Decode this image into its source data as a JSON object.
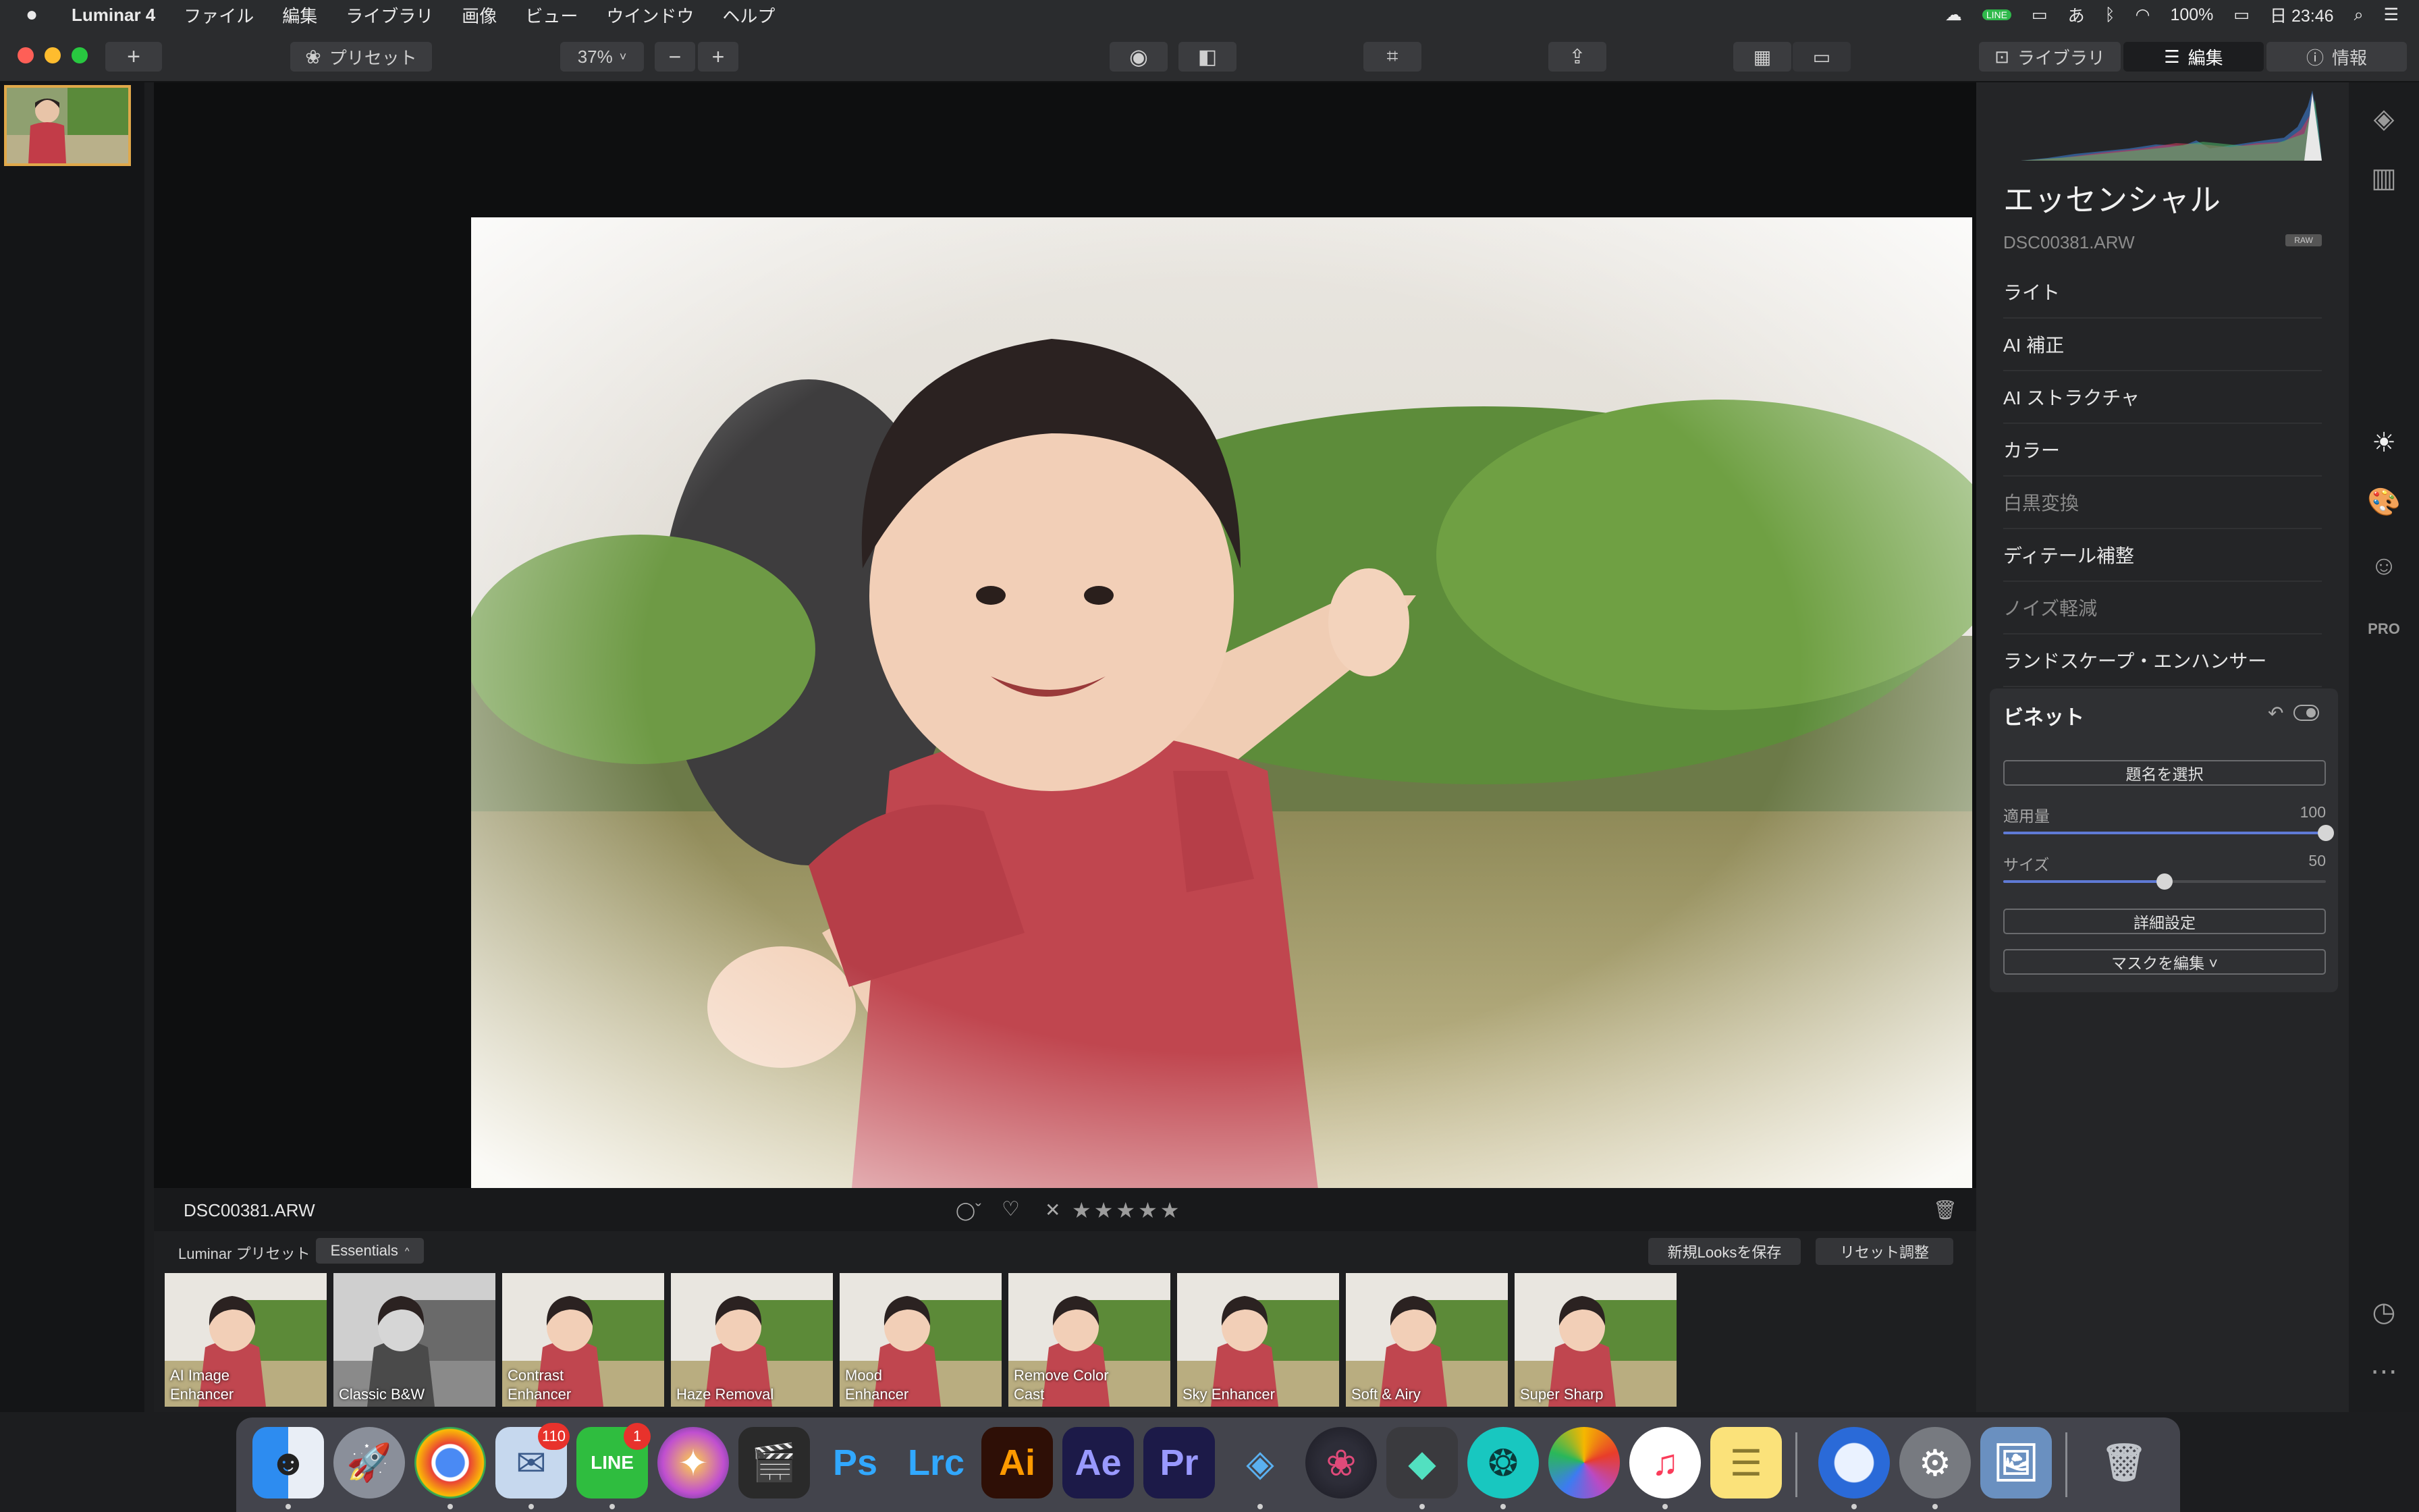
{
  "menubar": {
    "app_name": "Luminar 4",
    "items": [
      "ファイル",
      "編集",
      "ライブラリ",
      "画像",
      "ビュー",
      "ウインドウ",
      "ヘルプ"
    ],
    "battery": "100%",
    "clock": "日 23:46",
    "line_label": "LINE"
  },
  "toolbar": {
    "presets_label": "プリセット",
    "zoom": "37%",
    "zoom_out": "−",
    "zoom_in": "+",
    "add": "+",
    "tab_library": "ライブラリ",
    "tab_edit": "編集",
    "tab_info": "情報"
  },
  "viewer": {
    "filename": "DSC00381.ARW",
    "stars": "★★★★★",
    "reject": "✕",
    "flag_label": "◯ˇ",
    "heart": "♡"
  },
  "presets": {
    "label": "Luminar プリセット",
    "category": "Essentials",
    "save_looks": "新規Looksを保存",
    "reset": "リセット調整",
    "thumbs": [
      {
        "line1": "AI Image",
        "line2": "Enhancer",
        "mono": false
      },
      {
        "line1": "Classic B&W",
        "line2": "",
        "mono": true
      },
      {
        "line1": "Contrast",
        "line2": "Enhancer",
        "mono": false
      },
      {
        "line1": "Haze Removal",
        "line2": "",
        "mono": false
      },
      {
        "line1": "Mood",
        "line2": "Enhancer",
        "mono": false
      },
      {
        "line1": "Remove Color",
        "line2": "Cast",
        "mono": false
      },
      {
        "line1": "Sky Enhancer",
        "line2": "",
        "mono": false
      },
      {
        "line1": "Soft & Airy",
        "line2": "",
        "mono": false
      },
      {
        "line1": "Super Sharp",
        "line2": "",
        "mono": false
      }
    ]
  },
  "panel": {
    "title": "エッセンシャル",
    "filename": "DSC00381.ARW",
    "raw_badge": "RAW",
    "sections": [
      {
        "label": "ライト",
        "dim": false
      },
      {
        "label": "AI 補正",
        "dim": false
      },
      {
        "label": "AI ストラクチャ",
        "dim": false
      },
      {
        "label": "カラー",
        "dim": false
      },
      {
        "label": "白黒変換",
        "dim": true
      },
      {
        "label": "ディテール補整",
        "dim": false
      },
      {
        "label": "ノイズ軽減",
        "dim": true
      },
      {
        "label": "ランドスケープ・エンハンサー",
        "dim": false
      }
    ],
    "vignette": {
      "title": "ビネット",
      "select_subject": "題名を選択",
      "amount_label": "適用量",
      "amount_value": "100",
      "amount_fraction": 1.0,
      "size_label": "サイズ",
      "size_value": "50",
      "size_fraction": 0.5,
      "advanced": "詳細設定",
      "edit_mask": "マスクを編集 ˅"
    },
    "pro_label": "PRO"
  },
  "dock": {
    "mail_badge": "110",
    "line_badge": "1",
    "line_label": "LINE",
    "ps": "Ps",
    "lrc": "Lrc",
    "ai": "Ai",
    "ae": "Ae",
    "pr": "Pr"
  }
}
